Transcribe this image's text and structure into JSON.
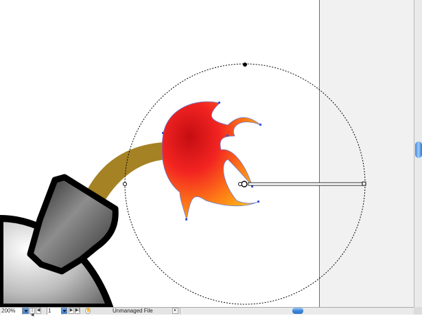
{
  "status_bar": {
    "zoom": "200%",
    "page": "1",
    "file_status": "Unmanaged File"
  },
  "nav_icons": {
    "first": "|◀",
    "prev": "◀",
    "next": "▶",
    "last": "▶|",
    "hand": "hand-icon"
  },
  "colors": {
    "scroll_accent": "#3d86d8",
    "pasteboard": "#f1f1f1",
    "fuse": "#a58224",
    "flame_red": "#d4101e",
    "flame_yellow": "#ffc21c"
  }
}
